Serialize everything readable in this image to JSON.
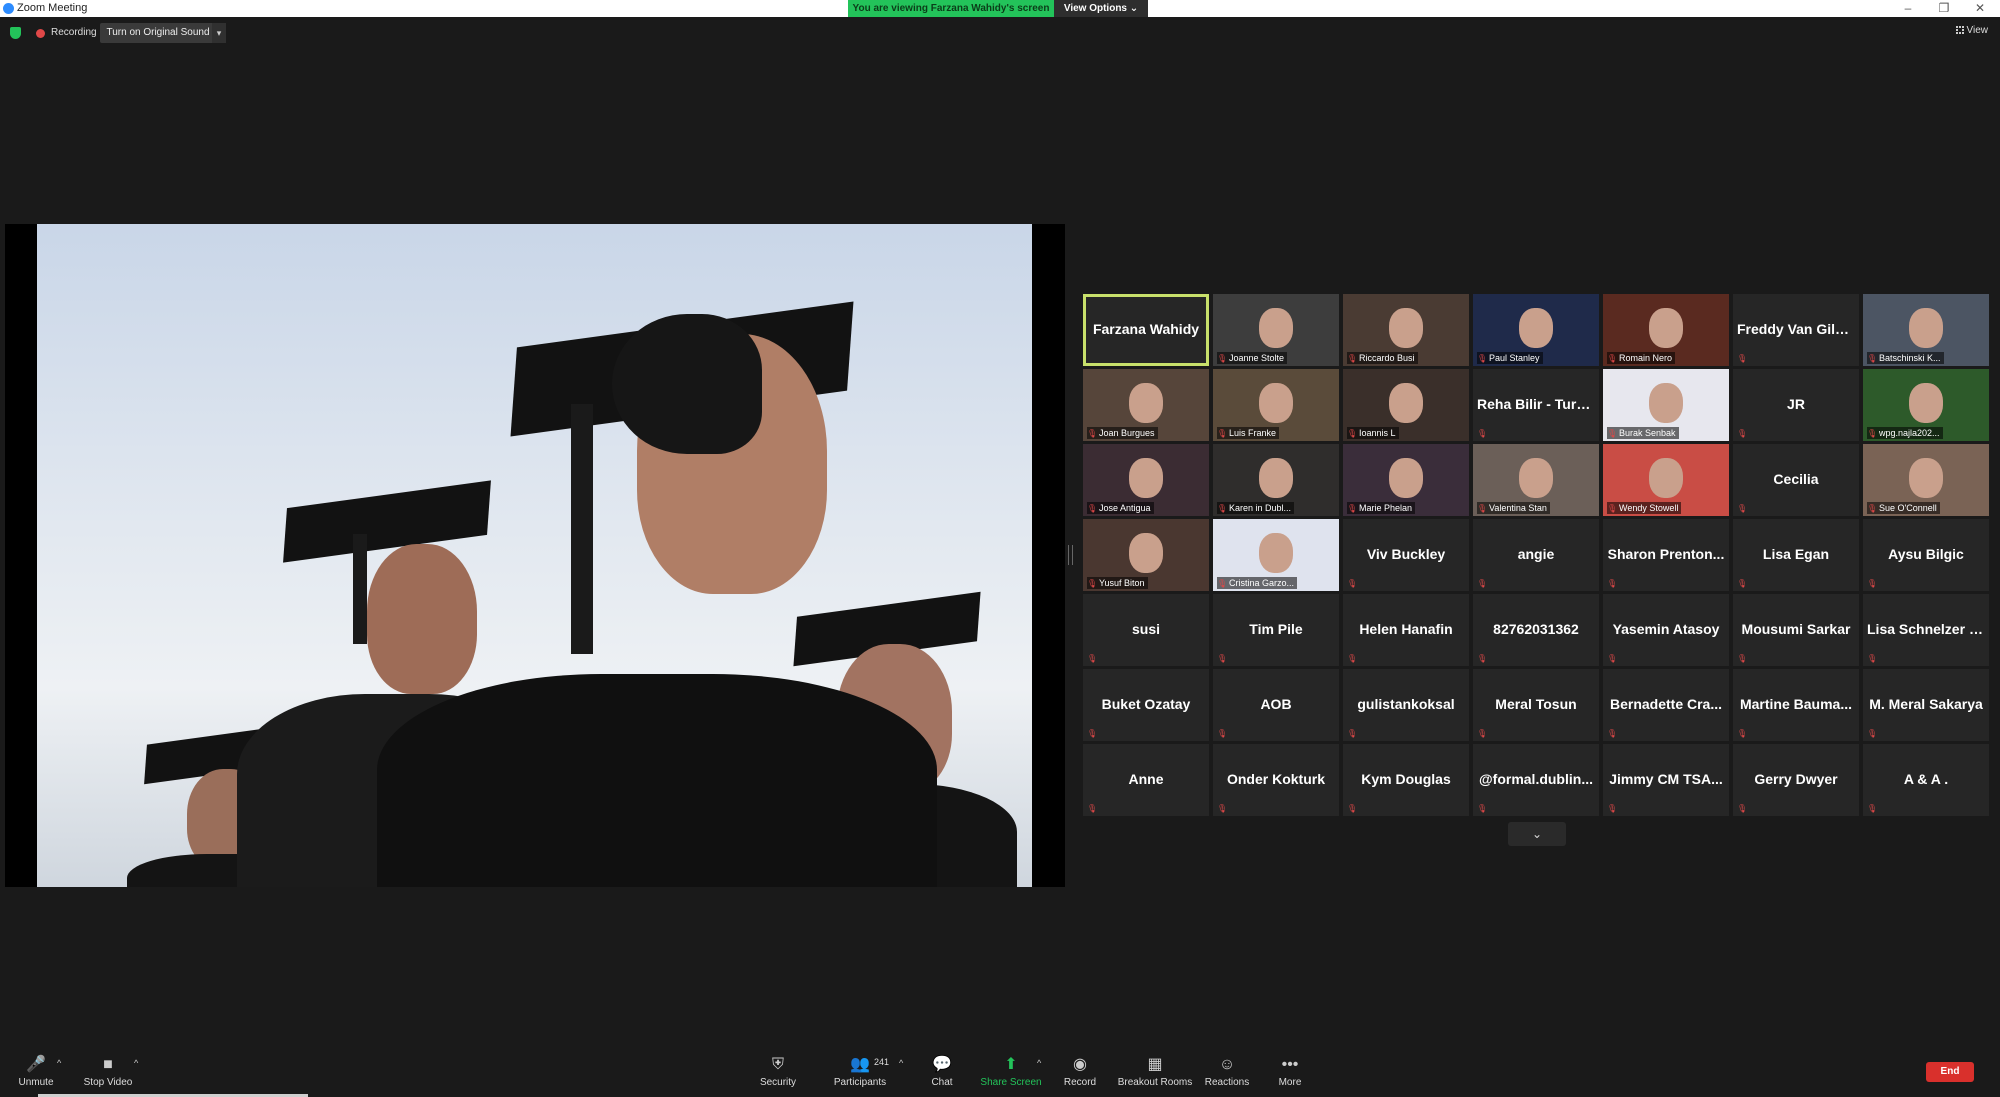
{
  "window": {
    "title": "Zoom Meeting",
    "controls": [
      "–",
      "❐",
      "✕"
    ]
  },
  "banner": {
    "viewing": "You are viewing Farzana Wahidy's screen",
    "view_options": "View Options ⌄"
  },
  "topbar": {
    "recording": "Recording",
    "original_sound": "Turn on Original Sound",
    "view": "View"
  },
  "gallery": {
    "tiles": [
      {
        "name": "Farzana Wahidy",
        "style": "big",
        "active": true
      },
      {
        "name": "Joanne Stolte",
        "style": "video"
      },
      {
        "name": "Riccardo Busi",
        "style": "video"
      },
      {
        "name": "Paul Stanley",
        "style": "video"
      },
      {
        "name": "Romain Nero",
        "style": "video"
      },
      {
        "name": "Freddy Van Gilb...",
        "style": "big"
      },
      {
        "name": "Batschinski K...",
        "style": "video"
      },
      {
        "name": "Joan Burgues",
        "style": "video"
      },
      {
        "name": "Luis Franke",
        "style": "video"
      },
      {
        "name": "Ioannis L",
        "style": "video"
      },
      {
        "name": "Reha Bilir - Turk...",
        "style": "big"
      },
      {
        "name": "Burak Senbak",
        "style": "video"
      },
      {
        "name": "JR",
        "style": "big"
      },
      {
        "name": "wpg.najla202...",
        "style": "video"
      },
      {
        "name": "Jose Antigua",
        "style": "video"
      },
      {
        "name": "Karen in Dubl...",
        "style": "video"
      },
      {
        "name": "Marie Phelan",
        "style": "video"
      },
      {
        "name": "Valentina Stan",
        "style": "video"
      },
      {
        "name": "Wendy Stowell",
        "style": "video"
      },
      {
        "name": "Cecilia",
        "style": "big"
      },
      {
        "name": "Sue O'Connell",
        "style": "video"
      },
      {
        "name": "Yusuf Biton",
        "style": "video"
      },
      {
        "name": "Cristina Garzo...",
        "style": "video"
      },
      {
        "name": "Viv Buckley",
        "style": "big"
      },
      {
        "name": "angie",
        "style": "big"
      },
      {
        "name": "Sharon Prenton...",
        "style": "big"
      },
      {
        "name": "Lisa Egan",
        "style": "big"
      },
      {
        "name": "Aysu Bilgic",
        "style": "big"
      },
      {
        "name": "susi",
        "style": "big"
      },
      {
        "name": "Tim Pile",
        "style": "big"
      },
      {
        "name": "Helen Hanafin",
        "style": "big"
      },
      {
        "name": "82762031362",
        "style": "big"
      },
      {
        "name": "Yasemin Atasoy",
        "style": "big"
      },
      {
        "name": "Mousumi Sarkar",
        "style": "big"
      },
      {
        "name": "Lisa Schnelzer -...",
        "style": "big"
      },
      {
        "name": "Buket Ozatay",
        "style": "big"
      },
      {
        "name": "AOB",
        "style": "big"
      },
      {
        "name": "gulistankoksal",
        "style": "big"
      },
      {
        "name": "Meral Tosun",
        "style": "big"
      },
      {
        "name": "Bernadette Cra...",
        "style": "big"
      },
      {
        "name": "Martine Bauma...",
        "style": "big"
      },
      {
        "name": "M. Meral Sakarya",
        "style": "big"
      },
      {
        "name": "Anne",
        "style": "big"
      },
      {
        "name": "Onder Kokturk",
        "style": "big"
      },
      {
        "name": "Kym Douglas",
        "style": "big"
      },
      {
        "name": "@formal.dublin...",
        "style": "big"
      },
      {
        "name": "Jimmy CM TSA...",
        "style": "big"
      },
      {
        "name": "Gerry Dwyer",
        "style": "big"
      },
      {
        "name": "A & A .",
        "style": "big"
      }
    ],
    "video_colors": [
      "#3d3d3d",
      "#4a3b33",
      "#1f2a4a",
      "#5a2a20",
      "#4c5563",
      "#56453a",
      "#5a4b3a",
      "#3a2f2a",
      "#e7e7ee",
      "#2d5a2a",
      "#3b2c33",
      "#2f2d2c",
      "#3a2d3a",
      "#6b5f58",
      "#c94d45",
      "#7a6355",
      "#4a3730",
      "#dfe3ee",
      "#2b2540"
    ]
  },
  "toolbar": {
    "unmute": "Unmute",
    "stop_video": "Stop Video",
    "security": "Security",
    "participants": "Participants",
    "participants_count": "241",
    "chat": "Chat",
    "share_screen": "Share Screen",
    "record": "Record",
    "breakout_rooms": "Breakout Rooms",
    "reactions": "Reactions",
    "more": "More",
    "end": "End"
  },
  "colors": {
    "accent_green": "#23c35a",
    "active_speaker": "#c8e06b",
    "end_red": "#d9302c",
    "muted_red": "#e04848"
  }
}
